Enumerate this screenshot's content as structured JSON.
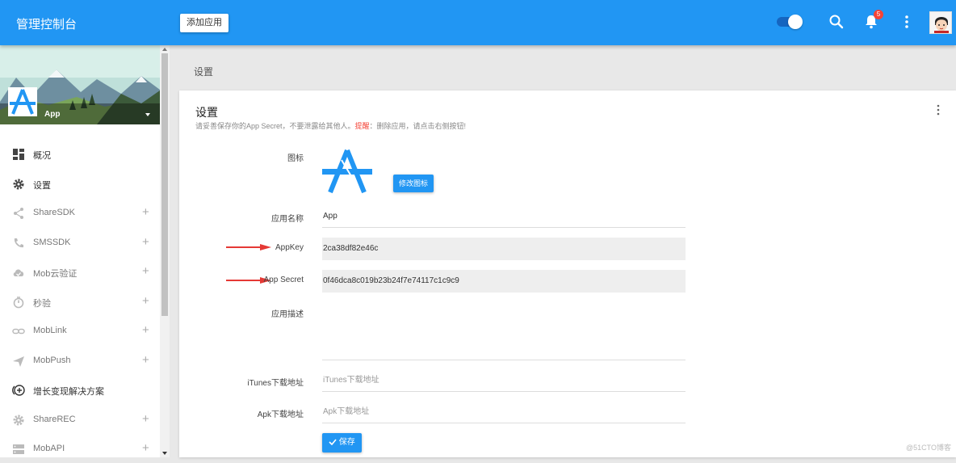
{
  "header": {
    "brand": "管理控制台",
    "add_app_label": "添加应用",
    "notification_count": "5",
    "accent_color": "#2196f3"
  },
  "sidebar": {
    "app_name": "App",
    "items": [
      {
        "label": "概况",
        "icon": "dashboard-icon",
        "expandable": false
      },
      {
        "label": "设置",
        "icon": "gear-icon",
        "expandable": false
      },
      {
        "label": "ShareSDK",
        "icon": "share-icon",
        "expandable": true
      },
      {
        "label": "SMSSDK",
        "icon": "phone-icon",
        "expandable": true
      },
      {
        "label": "Mob云验证",
        "icon": "cloud-check-icon",
        "expandable": true
      },
      {
        "label": "秒验",
        "icon": "timer-icon",
        "expandable": true
      },
      {
        "label": "MobLink",
        "icon": "link-icon",
        "expandable": true
      },
      {
        "label": "MobPush",
        "icon": "send-icon",
        "expandable": true
      },
      {
        "label": "增长变现解决方案",
        "icon": "add-circle-icon",
        "expandable": false
      },
      {
        "label": "ShareREC",
        "icon": "gear-icon",
        "expandable": true
      },
      {
        "label": "MobAPI",
        "icon": "server-icon",
        "expandable": true
      }
    ],
    "plus_symbol": "+"
  },
  "breadcrumb": "设置",
  "card": {
    "title": "设置",
    "subtitle_prefix": "请妥善保存你的App Secret，不要泄露给其他人。",
    "subtitle_warn": "提醒",
    "subtitle_suffix": "：删除应用，请点击右侧按钮!",
    "icon_label": "图标",
    "edit_icon_button": "修改图标",
    "fields": {
      "app_name_label": "应用名称",
      "app_name_value": "App",
      "appkey_label": "AppKey",
      "appkey_value": "2ca38df82e46c",
      "appsecret_label": "App Secret",
      "appsecret_value": "0f46dca8c019b23b24f7e74117c1c9c9",
      "desc_label": "应用描述",
      "itunes_label": "iTunes下载地址",
      "itunes_placeholder": "iTunes下载地址",
      "apk_label": "Apk下载地址",
      "apk_placeholder": "Apk下载地址"
    },
    "save_button": "保存"
  },
  "watermark": "@51CTO博客"
}
